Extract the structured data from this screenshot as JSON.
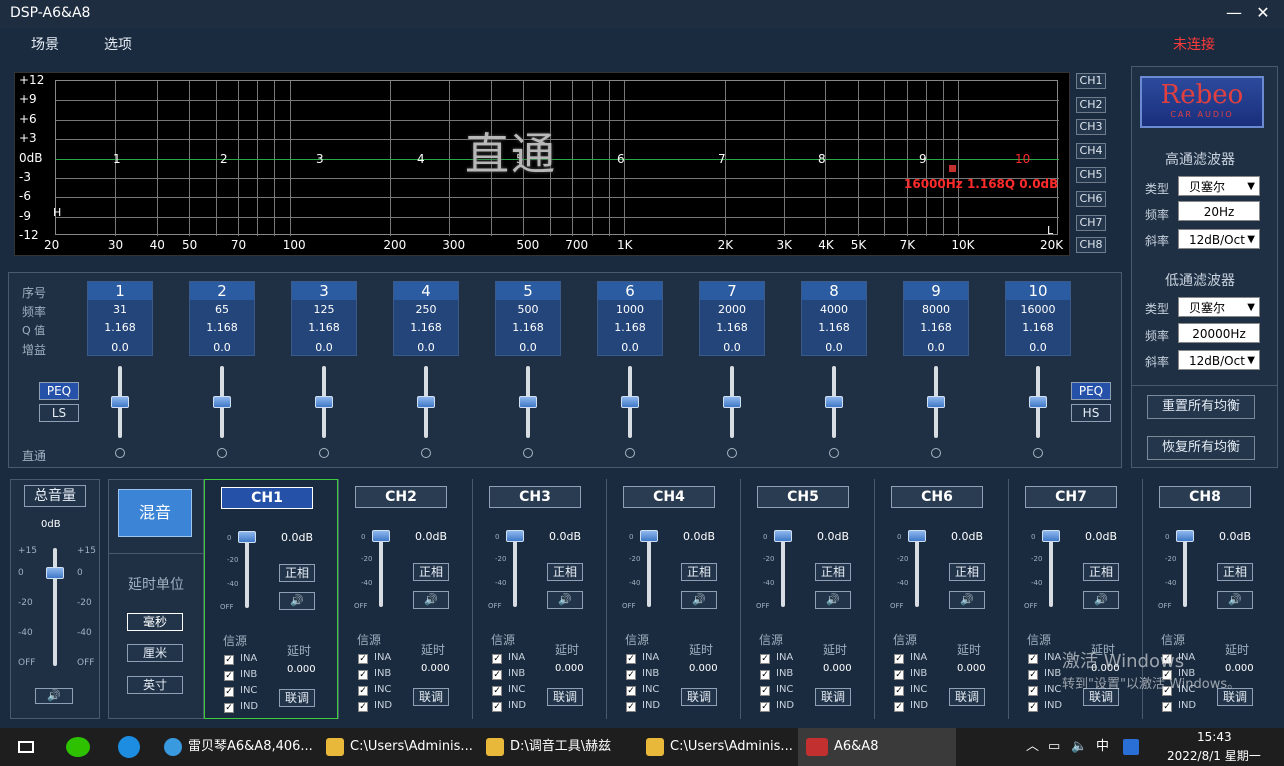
{
  "window": {
    "title": "DSP-A6&A8",
    "minimize": "—",
    "close": "✕"
  },
  "menu": {
    "items": [
      "场景",
      "选项"
    ],
    "status": "未连接"
  },
  "graph": {
    "y_ticks": [
      "+12",
      "+9",
      "+6",
      "+3",
      "0dB",
      "-3",
      "-6",
      "-9",
      "-12"
    ],
    "x_ticks": [
      "20",
      "30",
      "40",
      "50",
      "70",
      "100",
      "200",
      "300",
      "500",
      "700",
      "1K",
      "2K",
      "3K",
      "4K",
      "5K",
      "7K",
      "10K",
      "20K"
    ],
    "band_markers": [
      "1",
      "2",
      "3",
      "4",
      "5",
      "6",
      "7",
      "8",
      "9",
      "10"
    ],
    "band_markers_red": "10",
    "overlay": "直通",
    "band_info": "16000Hz 1.168Q 0.0dB",
    "h_markers": [
      "H",
      "L"
    ]
  },
  "channel_selectors": [
    "CH1",
    "CH2",
    "CH3",
    "CH4",
    "CH5",
    "CH6",
    "CH7",
    "CH8"
  ],
  "right_panel": {
    "logo_text": "Rebeo",
    "logo_sub": "CAR AUDIO",
    "highpass": {
      "title": "高通滤波器",
      "type_label": "类型",
      "type": "贝塞尔",
      "freq_label": "频率",
      "freq": "20Hz",
      "slope_label": "斜率",
      "slope": "12dB/Oct"
    },
    "lowpass": {
      "title": "低通滤波器",
      "type_label": "类型",
      "type": "贝塞尔",
      "freq_label": "频率",
      "freq": "20000Hz",
      "slope_label": "斜率",
      "slope": "12dB/Oct"
    },
    "reset_all": "重置所有均衡",
    "restore_all": "恢复所有均衡"
  },
  "eq": {
    "row_labels": {
      "index": "序号",
      "freq": "频率",
      "q": "Q 值",
      "gain": "增益",
      "bypass": "直通"
    },
    "bands": [
      {
        "n": "1",
        "freq": "31",
        "q": "1.168",
        "gain": "0.0"
      },
      {
        "n": "2",
        "freq": "65",
        "q": "1.168",
        "gain": "0.0"
      },
      {
        "n": "3",
        "freq": "125",
        "q": "1.168",
        "gain": "0.0"
      },
      {
        "n": "4",
        "freq": "250",
        "q": "1.168",
        "gain": "0.0"
      },
      {
        "n": "5",
        "freq": "500",
        "q": "1.168",
        "gain": "0.0"
      },
      {
        "n": "6",
        "freq": "1000",
        "q": "1.168",
        "gain": "0.0"
      },
      {
        "n": "7",
        "freq": "2000",
        "q": "1.168",
        "gain": "0.0"
      },
      {
        "n": "8",
        "freq": "4000",
        "q": "1.168",
        "gain": "0.0"
      },
      {
        "n": "9",
        "freq": "8000",
        "q": "1.168",
        "gain": "0.0"
      },
      {
        "n": "10",
        "freq": "16000",
        "q": "1.168",
        "gain": "0.0"
      }
    ],
    "left_peq": "PEQ",
    "left_ls": "LS",
    "right_peq": "PEQ",
    "right_hs": "HS"
  },
  "master": {
    "label": "总音量",
    "value": "0dB",
    "scale_left": [
      "+15",
      "0",
      "-20",
      "-40",
      "OFF"
    ],
    "scale_right": [
      "+15",
      "0",
      "-20",
      "-40",
      "OFF"
    ],
    "mute_icon": "speaker-icon"
  },
  "mix": {
    "label": "混音",
    "delay_unit_label": "延时单位",
    "units": [
      "毫秒",
      "厘米",
      "英寸"
    ],
    "selected_unit": "毫秒"
  },
  "channels": [
    {
      "name": "CH1",
      "gain": "0.0dB",
      "phase": "正相",
      "source_label": "信源",
      "delay_label": "延时",
      "delay": "0.000",
      "link": "联调",
      "inputs": [
        "INA",
        "INB",
        "INC",
        "IND"
      ]
    },
    {
      "name": "CH2",
      "gain": "0.0dB",
      "phase": "正相",
      "source_label": "信源",
      "delay_label": "延时",
      "delay": "0.000",
      "link": "联调",
      "inputs": [
        "INA",
        "INB",
        "INC",
        "IND"
      ]
    },
    {
      "name": "CH3",
      "gain": "0.0dB",
      "phase": "正相",
      "source_label": "信源",
      "delay_label": "延时",
      "delay": "0.000",
      "link": "联调",
      "inputs": [
        "INA",
        "INB",
        "INC",
        "IND"
      ]
    },
    {
      "name": "CH4",
      "gain": "0.0dB",
      "phase": "正相",
      "source_label": "信源",
      "delay_label": "延时",
      "delay": "0.000",
      "link": "联调",
      "inputs": [
        "INA",
        "INB",
        "INC",
        "IND"
      ]
    },
    {
      "name": "CH5",
      "gain": "0.0dB",
      "phase": "正相",
      "source_label": "信源",
      "delay_label": "延时",
      "delay": "0.000",
      "link": "联调",
      "inputs": [
        "INA",
        "INB",
        "INC",
        "IND"
      ]
    },
    {
      "name": "CH6",
      "gain": "0.0dB",
      "phase": "正相",
      "source_label": "信源",
      "delay_label": "延时",
      "delay": "0.000",
      "link": "联调",
      "inputs": [
        "INA",
        "INB",
        "INC",
        "IND"
      ]
    },
    {
      "name": "CH7",
      "gain": "0.0dB",
      "phase": "正相",
      "source_label": "信源",
      "delay_label": "延时",
      "delay": "0.000",
      "link": "联调",
      "inputs": [
        "INA",
        "INB",
        "INC",
        "IND"
      ]
    },
    {
      "name": "CH8",
      "gain": "0.0dB",
      "phase": "正相",
      "source_label": "信源",
      "delay_label": "延时",
      "delay": "0.000",
      "link": "联调",
      "inputs": [
        "INA",
        "INB",
        "INC",
        "IND"
      ]
    }
  ],
  "channel_scale": [
    "0",
    "-20",
    "-40",
    "OFF"
  ],
  "watermark": {
    "line1": "激活 Windows",
    "line2": "转到\"设置\"以激活 Windows。"
  },
  "taskbar": {
    "items": [
      "雷贝琴A6&A8,406...",
      "C:\\Users\\Adminis...",
      "D:\\调音工具\\赫兹",
      "C:\\Users\\Adminis...",
      "A6&A8"
    ],
    "time": "15:43",
    "date": "2022/8/1 星期一",
    "ime": "中"
  },
  "colors": {
    "accent": "#2552a8",
    "status_red": "#ff3a3a",
    "active_border": "#3ccc3c"
  }
}
